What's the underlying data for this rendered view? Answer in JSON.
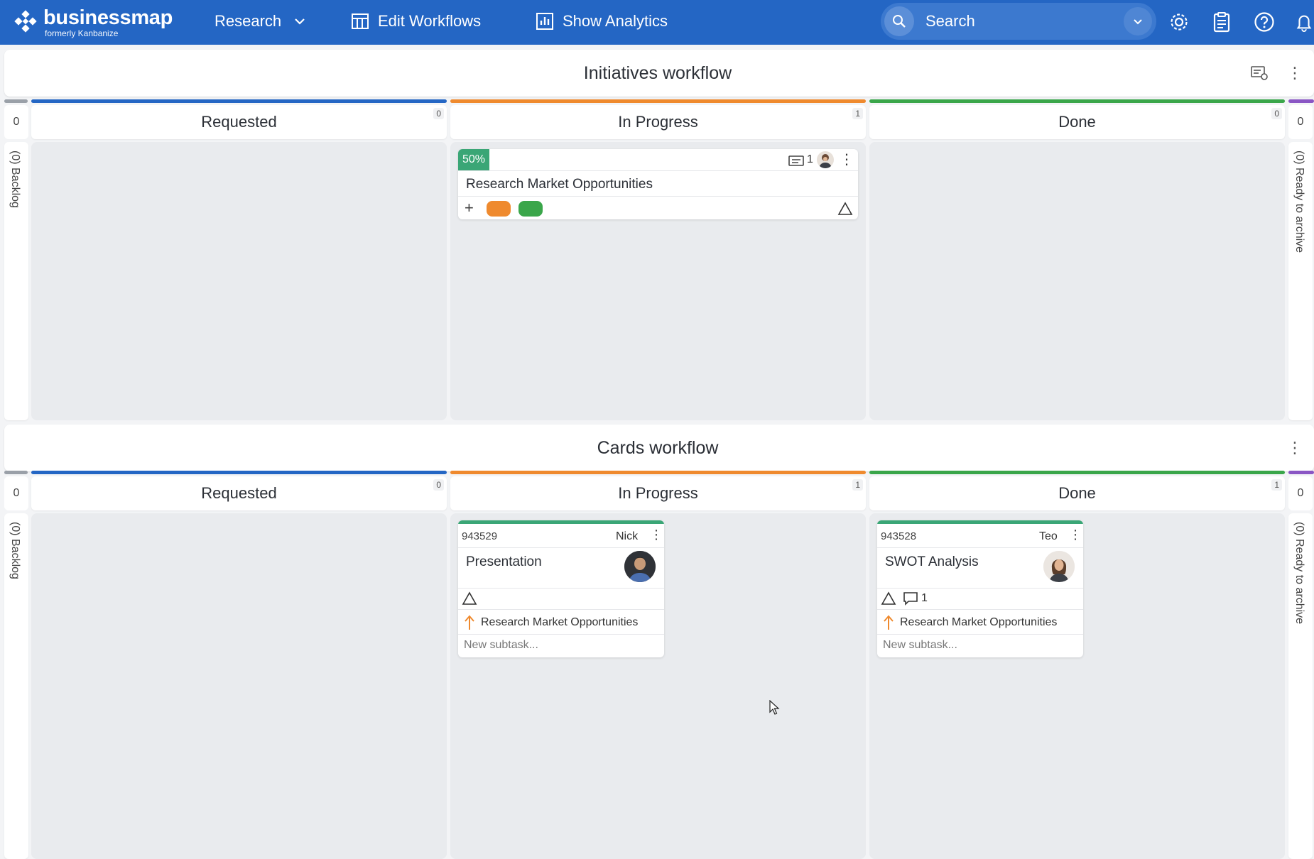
{
  "app": {
    "logo_name": "businessmap",
    "logo_sub": "formerly Kanbanize"
  },
  "nav": {
    "board": "Research",
    "edit_workflows": "Edit Workflows",
    "show_analytics": "Show Analytics"
  },
  "search": {
    "placeholder": "Search"
  },
  "colors": {
    "topbar": "#2466c4",
    "requested": "#2466c4",
    "in_progress": "#ef8a2e",
    "done": "#3aa64a",
    "archive": "#8a56c4",
    "card_badge": "#3aa676"
  },
  "initiatives": {
    "title": "Initiatives workflow",
    "left_count": "0",
    "left_label": "(0) Backlog",
    "right_count": "0",
    "right_label": "(0) Ready to archive",
    "columns": [
      {
        "name": "Requested",
        "count": "0"
      },
      {
        "name": "In Progress",
        "count": "1"
      },
      {
        "name": "Done",
        "count": "0"
      }
    ],
    "card": {
      "progress": "50%",
      "comment_count": "1",
      "title": "Research Market Opportunities"
    }
  },
  "cards_workflow": {
    "title": "Cards workflow",
    "left_count": "0",
    "left_label": "(0) Backlog",
    "right_count": "0",
    "right_label": "(0) Ready to archive",
    "columns": [
      {
        "name": "Requested",
        "count": "0"
      },
      {
        "name": "In Progress",
        "count": "1"
      },
      {
        "name": "Done",
        "count": "1"
      }
    ],
    "cards": [
      {
        "id": "943529",
        "owner": "Nick",
        "title": "Presentation",
        "parent": "Research Market Opportunities",
        "subtask_placeholder": "New subtask..."
      },
      {
        "id": "943528",
        "owner": "Teo",
        "title": "SWOT Analysis",
        "comment_count": "1",
        "parent": "Research Market Opportunities",
        "subtask_placeholder": "New subtask..."
      }
    ]
  }
}
